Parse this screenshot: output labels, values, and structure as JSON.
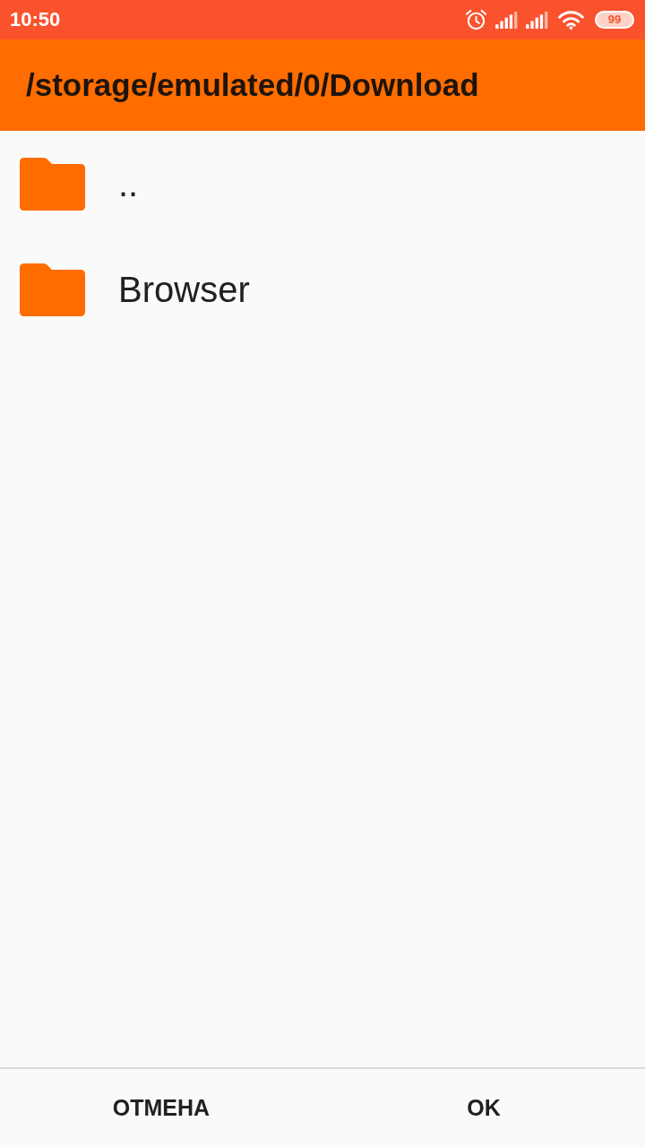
{
  "status_bar": {
    "time": "10:50",
    "battery": "99"
  },
  "app_bar": {
    "title": "/storage/emulated/0/Download"
  },
  "entries": [
    {
      "name": ".."
    },
    {
      "name": "Browser"
    }
  ],
  "buttons": [
    {
      "label": "ОТМЕНА"
    },
    {
      "label": "OK"
    }
  ]
}
